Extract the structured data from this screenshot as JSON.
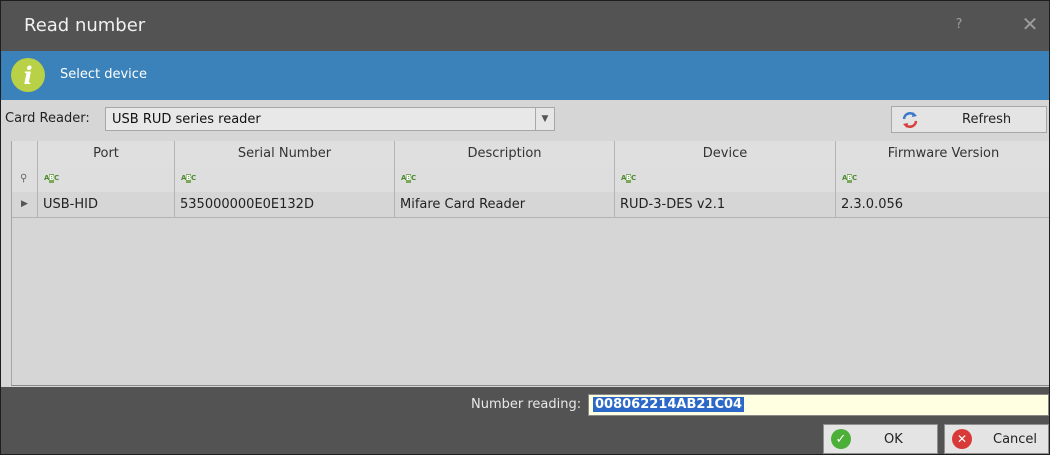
{
  "window": {
    "title": "Read number",
    "help_glyph": "?",
    "close_glyph": "✕"
  },
  "info": {
    "text": "Select device",
    "icon_glyph": "i"
  },
  "card_reader": {
    "label": "Card Reader:",
    "value": "USB RUD series reader",
    "refresh_label": "Refresh"
  },
  "grid": {
    "columns": [
      "Port",
      "Serial Number",
      "Description",
      "Device",
      "Firmware Version"
    ],
    "rows": [
      {
        "port": "USB-HID",
        "serial": "535000000E0E132D",
        "description": "Mifare Card Reader",
        "device": "RUD-3-DES v2.1",
        "firmware": "2.3.0.056"
      }
    ]
  },
  "number_reading": {
    "label": "Number reading:",
    "value": "008062214AB21C04"
  },
  "buttons": {
    "ok": "OK",
    "cancel": "Cancel"
  },
  "colors": {
    "info_bar": "#3a82b9",
    "info_icon": "#b8d146",
    "ok_icon": "#4caf38",
    "cancel_icon": "#d83a3a",
    "selection": "#2b68c8"
  }
}
